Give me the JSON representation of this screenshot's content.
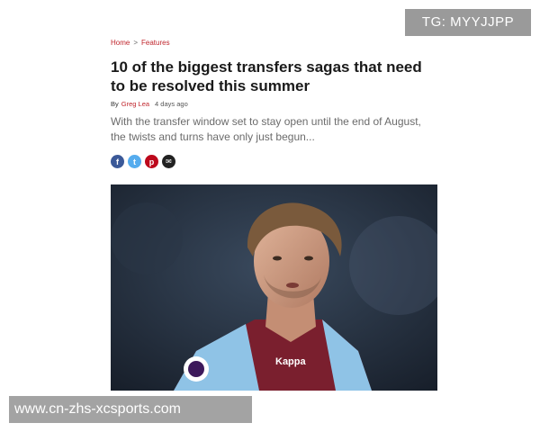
{
  "breadcrumb": {
    "home": "Home",
    "separator": ">",
    "section": "Features"
  },
  "article": {
    "title": "10 of the biggest transfers sagas that need to be resolved this summer",
    "byline_prefix": "By",
    "author": "Greg Lea",
    "date": "4 days ago",
    "standfirst": "With the transfer window set to stay open until the end of August, the twists and turns have only just begun...",
    "hero_image_caption": ""
  },
  "share": [
    {
      "name": "facebook-icon",
      "glyph": "f",
      "color": "#3b5998"
    },
    {
      "name": "twitter-icon",
      "glyph": "t",
      "color": "#55acee"
    },
    {
      "name": "pinterest-icon",
      "glyph": "p",
      "color": "#bd081c"
    },
    {
      "name": "email-icon",
      "glyph": "✉",
      "color": "#222222"
    }
  ],
  "hero": {
    "shirt_brand": "Kappa"
  },
  "watermarks": {
    "top": "TG: MYYJJPP",
    "bottom": "www.cn-zhs-xcsports.com"
  },
  "colors": {
    "link_red": "#c0262d",
    "claret": "#7a1f2e",
    "sky_blue": "#8fc3e6"
  }
}
